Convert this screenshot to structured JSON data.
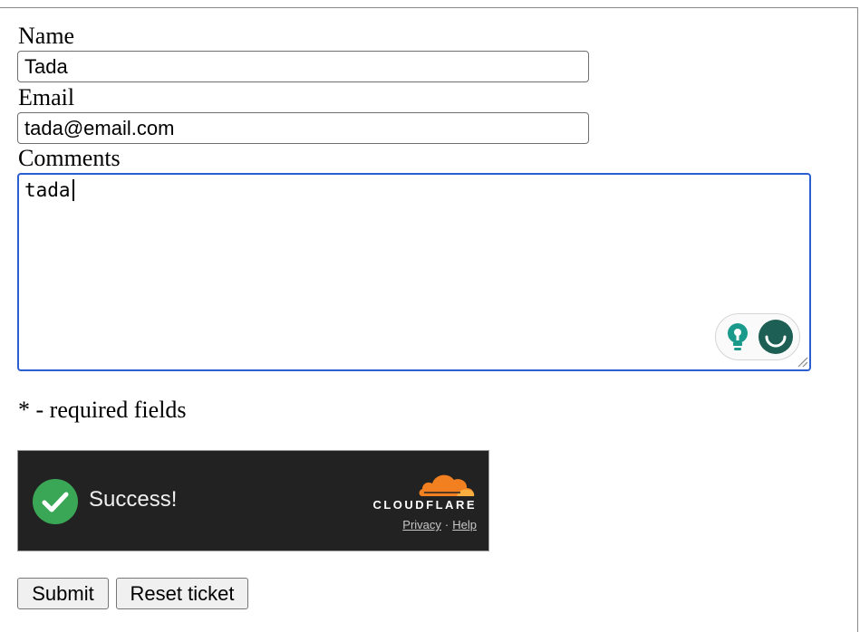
{
  "form": {
    "name_label": "Name",
    "name_value": "Tada",
    "email_label": "Email",
    "email_value": "tada@email.com",
    "comments_label": "Comments",
    "comments_value": "tada",
    "required_note": "* - required fields"
  },
  "turnstile": {
    "status": "Success!",
    "brand": "CLOUDFLARE",
    "privacy_link": "Privacy",
    "separator": "·",
    "help_link": "Help",
    "icons": [
      "checkmark-circle-icon",
      "cloudflare-cloud-icon"
    ],
    "colors": {
      "background": "#222222",
      "success": "#3aa757",
      "cloud": "#f38020"
    }
  },
  "grammar_assistant": {
    "icons": [
      "lightbulb-icon",
      "grammar-assistant-icon"
    ],
    "colors": {
      "accent": "#1a9a8a"
    }
  },
  "buttons": {
    "submit_label": "Submit",
    "reset_label": "Reset ticket"
  },
  "colors": {
    "focus_border": "#2b5fcf"
  }
}
